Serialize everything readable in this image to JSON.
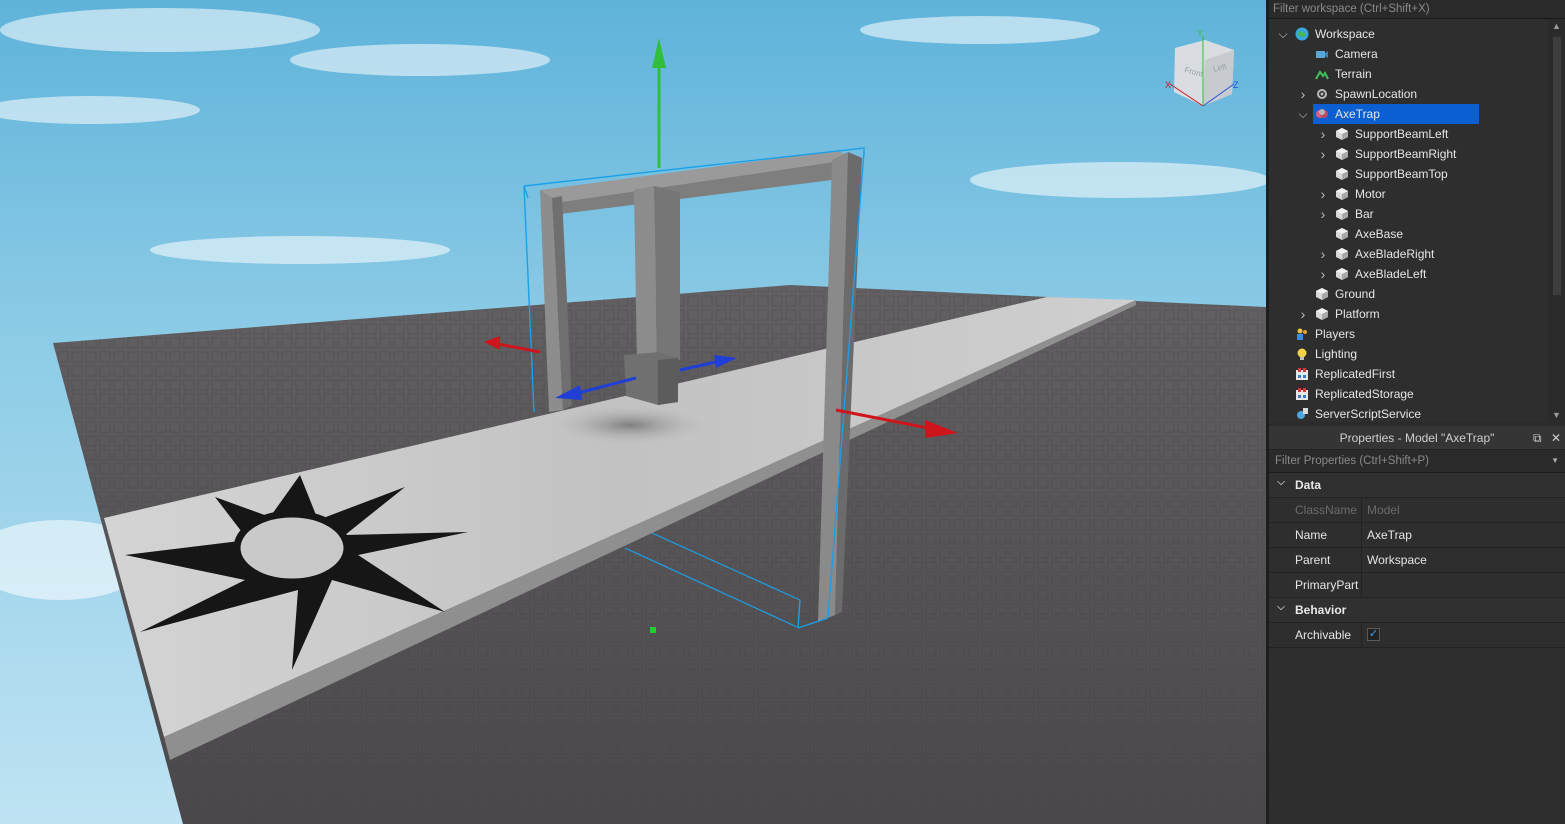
{
  "explorer": {
    "filter_placeholder": "Filter workspace (Ctrl+Shift+X)",
    "items": [
      {
        "label": "Workspace",
        "depth": 0,
        "expand": "open",
        "icon": "globe-icon"
      },
      {
        "label": "Camera",
        "depth": 1,
        "expand": "none",
        "icon": "camera-icon"
      },
      {
        "label": "Terrain",
        "depth": 1,
        "expand": "none",
        "icon": "terrain-icon"
      },
      {
        "label": "SpawnLocation",
        "depth": 1,
        "expand": "closed",
        "icon": "spawn-gear-icon"
      },
      {
        "label": "AxeTrap",
        "depth": 1,
        "expand": "open",
        "icon": "model-icon",
        "selected": true
      },
      {
        "label": "SupportBeamLeft",
        "depth": 2,
        "expand": "closed",
        "icon": "part-icon"
      },
      {
        "label": "SupportBeamRight",
        "depth": 2,
        "expand": "closed",
        "icon": "part-icon"
      },
      {
        "label": "SupportBeamTop",
        "depth": 2,
        "expand": "none",
        "icon": "part-icon"
      },
      {
        "label": "Motor",
        "depth": 2,
        "expand": "closed",
        "icon": "part-icon"
      },
      {
        "label": "Bar",
        "depth": 2,
        "expand": "closed",
        "icon": "part-icon"
      },
      {
        "label": "AxeBase",
        "depth": 2,
        "expand": "none",
        "icon": "part-icon"
      },
      {
        "label": "AxeBladeRight",
        "depth": 2,
        "expand": "closed",
        "icon": "part-icon"
      },
      {
        "label": "AxeBladeLeft",
        "depth": 2,
        "expand": "closed",
        "icon": "part-icon"
      },
      {
        "label": "Ground",
        "depth": 1,
        "expand": "none",
        "icon": "part-icon"
      },
      {
        "label": "Platform",
        "depth": 1,
        "expand": "closed",
        "icon": "part-icon"
      },
      {
        "label": "Players",
        "depth": 0,
        "expand": "none",
        "icon": "players-icon"
      },
      {
        "label": "Lighting",
        "depth": 0,
        "expand": "none",
        "icon": "lightbulb-icon"
      },
      {
        "label": "ReplicatedFirst",
        "depth": 0,
        "expand": "none",
        "icon": "replicated-icon"
      },
      {
        "label": "ReplicatedStorage",
        "depth": 0,
        "expand": "none",
        "icon": "replicated-icon"
      },
      {
        "label": "ServerScriptService",
        "depth": 0,
        "expand": "none",
        "icon": "script-service-icon"
      }
    ]
  },
  "properties": {
    "title": "Properties - Model \"AxeTrap\"",
    "filter_placeholder": "Filter Properties (Ctrl+Shift+P)",
    "sections": {
      "data": "Data",
      "behavior": "Behavior"
    },
    "rows": {
      "classname": {
        "name": "ClassName",
        "value": "Model"
      },
      "name": {
        "name": "Name",
        "value": "AxeTrap"
      },
      "parent": {
        "name": "Parent",
        "value": "Workspace"
      },
      "primarypart": {
        "name": "PrimaryPart",
        "value": ""
      },
      "archivable": {
        "name": "Archivable",
        "checked": true
      }
    }
  },
  "viewcube": {
    "front": "Front",
    "left": "Left",
    "x": "X",
    "y": "Y",
    "z": "Z"
  },
  "colors": {
    "selection": "#0b5fd1",
    "handle_x": "#d0141c",
    "handle_y": "#2fbf3a",
    "handle_z": "#1f3fd6",
    "selection_box": "#1aa0e8"
  }
}
